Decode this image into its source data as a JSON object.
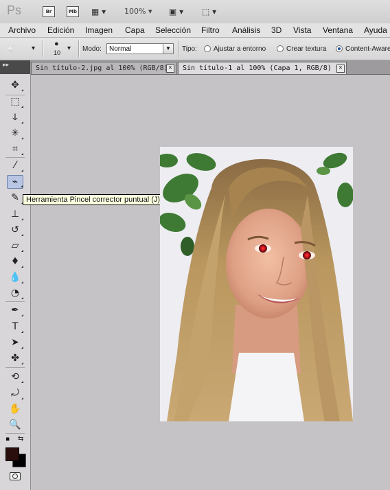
{
  "app": {
    "logo_text": "Ps",
    "bridge_label": "Br",
    "minibridge_label": "Mb",
    "zoom": "100%"
  },
  "menu": [
    "Archivo",
    "Edición",
    "Imagen",
    "Capa",
    "Selección",
    "Filtro",
    "Análisis",
    "3D",
    "Vista",
    "Ventana",
    "Ayuda"
  ],
  "options": {
    "brush_size": "10",
    "mode_label": "Modo:",
    "mode_value": "Normal",
    "type_label": "Tipo:",
    "radio_1": "Ajustar a entorno",
    "radio_2": "Crear textura",
    "radio_3": "Content-Aware",
    "selected_type": "Content-Aware"
  },
  "tabs": [
    {
      "label": "Sin título-2.jpg al 100% (RGB/8)",
      "active": false
    },
    {
      "label": "Sin título-1 al 100% (Capa 1, RGB/8) *",
      "active": true
    }
  ],
  "tooltip": "Herramienta Pincel corrector puntual (J)",
  "tools": [
    "move-tool-icon",
    "rectangular-marquee-icon",
    "lasso-icon",
    "quick-selection-icon",
    "crop-icon",
    "eyedropper-icon",
    "spot-healing-brush-icon",
    "brush-icon",
    "clone-stamp-icon",
    "history-brush-icon",
    "eraser-icon",
    "paint-bucket-icon",
    "blur-icon",
    "dodge-icon",
    "pen-icon",
    "type-icon",
    "path-selection-icon",
    "custom-shape-icon",
    "3d-rotate-icon",
    "3d-orbit-icon",
    "hand-icon",
    "zoom-icon"
  ],
  "colors": {
    "foreground": "#2a0d0d",
    "background": "#000000",
    "canvas_bg": "#c5c3c6",
    "selected_tool": "#b8c6e3"
  }
}
